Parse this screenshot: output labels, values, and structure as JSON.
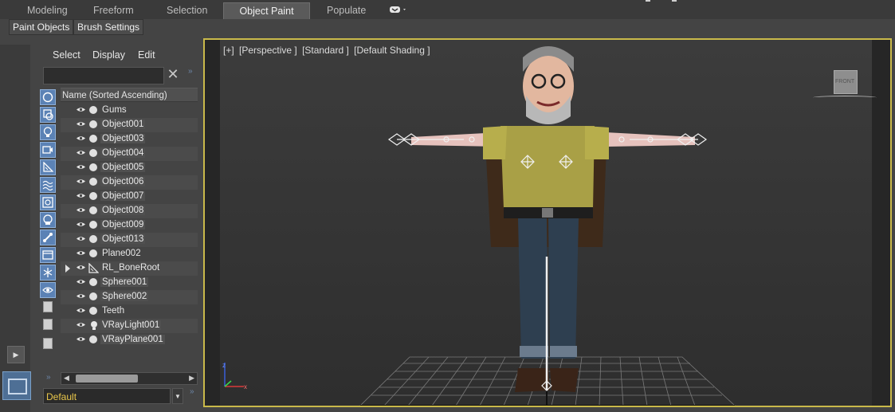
{
  "ribbon": {
    "tabs": [
      "Modeling",
      "Freeform",
      "Selection",
      "Object Paint",
      "Populate"
    ],
    "active_tab": "Object Paint"
  },
  "subtabs": [
    "Paint Objects",
    "Brush Settings"
  ],
  "explorer": {
    "menu": [
      "Select",
      "Display",
      "Edit"
    ],
    "search_value": "",
    "column_header": "Name (Sorted Ascending)",
    "objects": [
      {
        "name": "Gums",
        "type": "geometry"
      },
      {
        "name": "Object001",
        "type": "geometry"
      },
      {
        "name": "Object003",
        "type": "geometry"
      },
      {
        "name": "Object004",
        "type": "geometry"
      },
      {
        "name": "Object005",
        "type": "geometry"
      },
      {
        "name": "Object006",
        "type": "geometry"
      },
      {
        "name": "Object007",
        "type": "geometry"
      },
      {
        "name": "Object008",
        "type": "geometry"
      },
      {
        "name": "Object009",
        "type": "geometry"
      },
      {
        "name": "Object013",
        "type": "geometry"
      },
      {
        "name": "Plane002",
        "type": "geometry"
      },
      {
        "name": "RL_BoneRoot",
        "type": "bone",
        "expandable": true
      },
      {
        "name": "Sphere001",
        "type": "geometry"
      },
      {
        "name": "Sphere002",
        "type": "geometry"
      },
      {
        "name": "Teeth",
        "type": "geometry"
      },
      {
        "name": "VRayLight001",
        "type": "light"
      },
      {
        "name": "VRayPlane001",
        "type": "geometry"
      }
    ],
    "layer": "Default"
  },
  "viewport": {
    "labels": [
      "[+]",
      "[Perspective ]",
      "[Standard ]",
      "[Default Shading ]"
    ],
    "viewcube_face": "FRONT"
  },
  "colors": {
    "active_border": "#c9b94a",
    "filter_button": "#5b82b5",
    "layer_text": "#e8c64a"
  }
}
